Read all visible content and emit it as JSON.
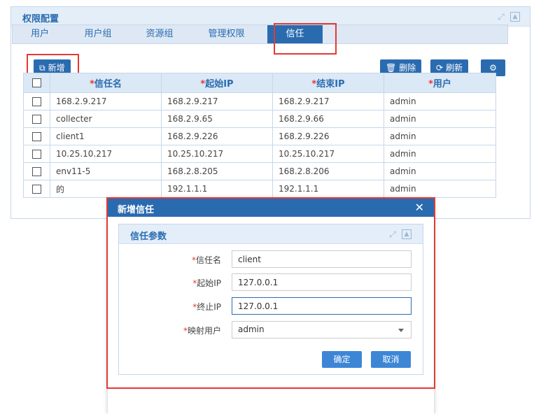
{
  "panel": {
    "title": "权限配置"
  },
  "tabs": [
    {
      "label": "用户"
    },
    {
      "label": "用户组"
    },
    {
      "label": "资源组"
    },
    {
      "label": "管理权限"
    },
    {
      "label": "信任"
    }
  ],
  "toolbar": {
    "add_label": "新增",
    "delete_label": "删除",
    "refresh_label": "刷新"
  },
  "table": {
    "headers": [
      "信任名",
      "起始IP",
      "结束IP",
      "用户"
    ],
    "rows": [
      [
        "168.2.9.217",
        "168.2.9.217",
        "168.2.9.217",
        "admin"
      ],
      [
        "collecter",
        "168.2.9.65",
        "168.2.9.66",
        "admin"
      ],
      [
        "client1",
        "168.2.9.226",
        "168.2.9.226",
        "admin"
      ],
      [
        "10.25.10.217",
        "10.25.10.217",
        "10.25.10.217",
        "admin"
      ],
      [
        "env11-5",
        "168.2.8.205",
        "168.2.8.206",
        "admin"
      ],
      [
        "的",
        "192.1.1.1",
        "192.1.1.1",
        "admin"
      ]
    ]
  },
  "dialog": {
    "title": "新增信任",
    "section_title": "信任参数",
    "fields": {
      "name_label": "信任名",
      "name_value": "client",
      "start_label": "起始IP",
      "start_value": "127.0.0.1",
      "end_label": "终止IP",
      "end_value": "127.0.0.1",
      "user_label": "映射用户",
      "user_value": "admin"
    },
    "ok_label": "确定",
    "cancel_label": "取消"
  },
  "colors": {
    "accent": "#2a6bb0",
    "highlight_border": "#e53935",
    "required_mark": "#e53935"
  }
}
